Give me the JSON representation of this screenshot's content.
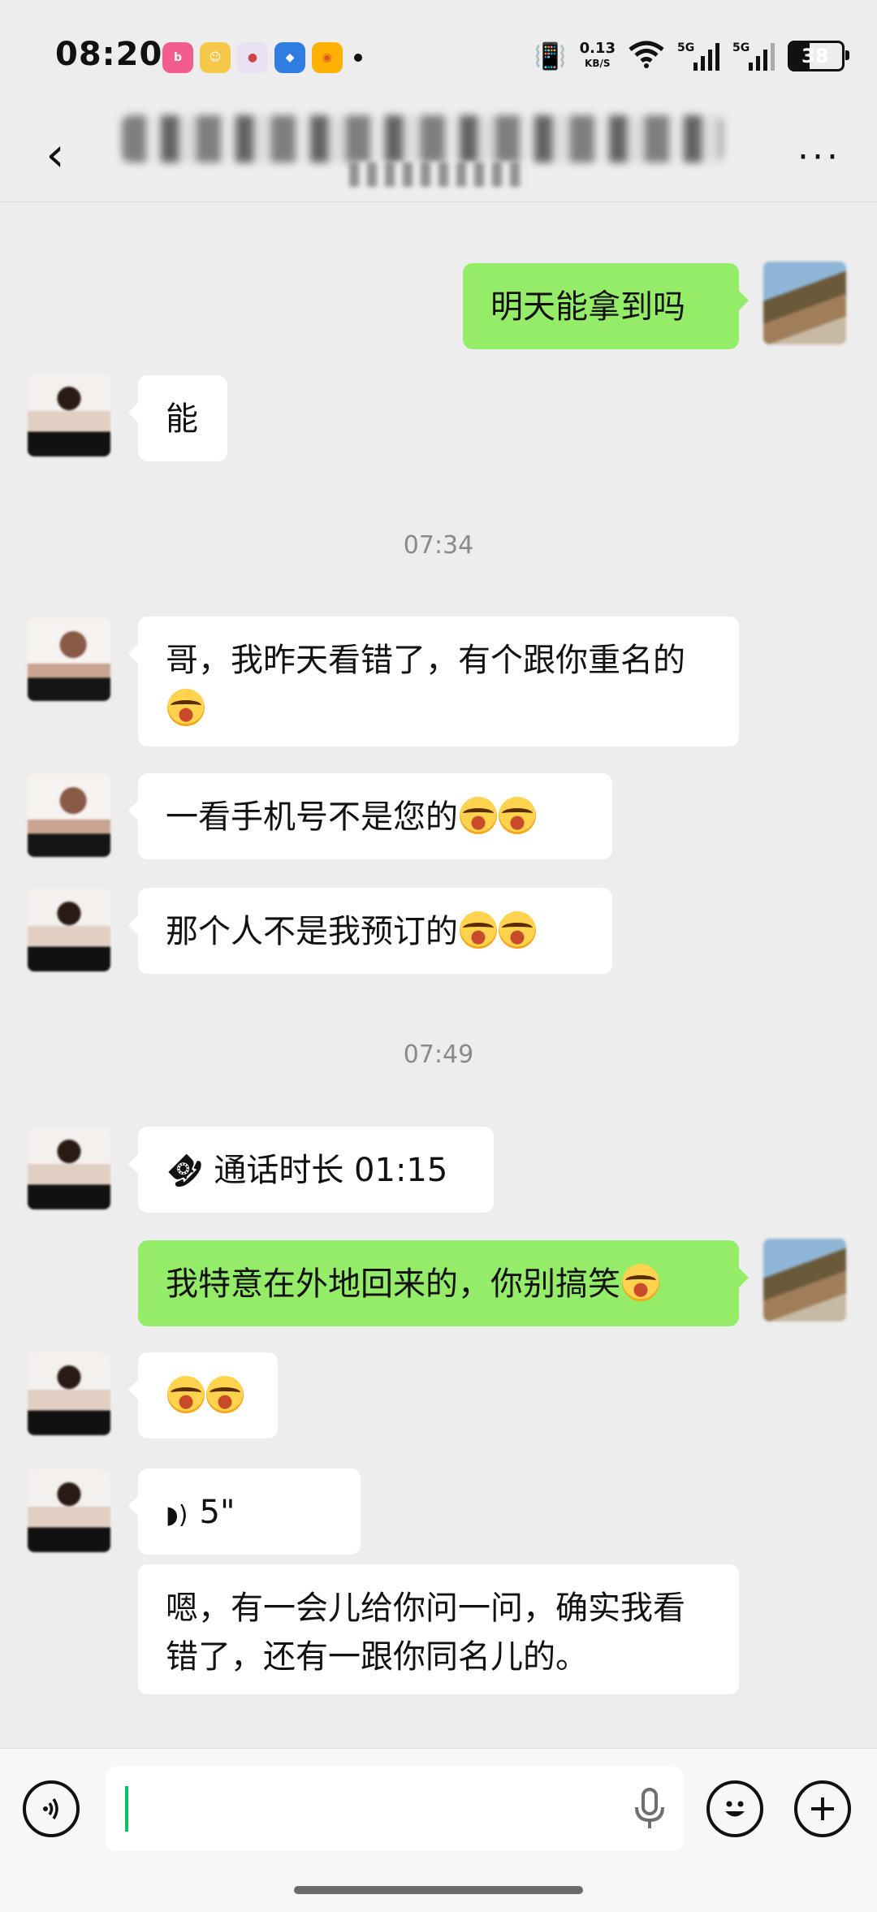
{
  "status_bar": {
    "time": "08:20",
    "app_icons": [
      "bilibili-icon",
      "clown-app-icon",
      "game-app-icon",
      "blue-app-icon",
      "weibo-icon"
    ],
    "net_speed_value": "0.13",
    "net_speed_unit": "KB/S",
    "sim1": "5G",
    "sim2": "5G",
    "battery": "38"
  },
  "header": {
    "back_icon": "chevron-left-icon",
    "more_icon": "more-dots-icon",
    "more_text": "···"
  },
  "messages": [
    {
      "side": "right",
      "type": "text",
      "text": "明天能拿到吗"
    },
    {
      "side": "left",
      "type": "text",
      "text": "能"
    },
    {
      "type": "timestamp",
      "text": "07:34"
    },
    {
      "side": "left",
      "type": "text",
      "text": "哥，我昨天看错了，有个跟你重名的",
      "emoji_count": 1
    },
    {
      "side": "left",
      "type": "text",
      "text": "一看手机号不是您的",
      "emoji_count": 2
    },
    {
      "side": "left",
      "type": "text",
      "text": "那个人不是我预订的",
      "emoji_count": 2
    },
    {
      "type": "timestamp",
      "text": "07:49"
    },
    {
      "side": "left",
      "type": "call",
      "text": "通话时长 01:15"
    },
    {
      "side": "right",
      "type": "text",
      "text": "我特意在外地回来的，你别搞笑",
      "emoji_count": 1
    },
    {
      "side": "left",
      "type": "text",
      "text": "",
      "emoji_count": 2
    },
    {
      "side": "left",
      "type": "voice",
      "text": "5\""
    },
    {
      "side": "left",
      "type": "transcript",
      "text": "嗯，有一会儿给你问一问，确实我看错了，还有一跟你同名儿的。"
    }
  ],
  "input_bar": {
    "voice_icon": "voice-mode-icon",
    "mic_icon": "microphone-icon",
    "emoji_icon": "emoji-icon",
    "plus_icon": "plus-icon"
  }
}
